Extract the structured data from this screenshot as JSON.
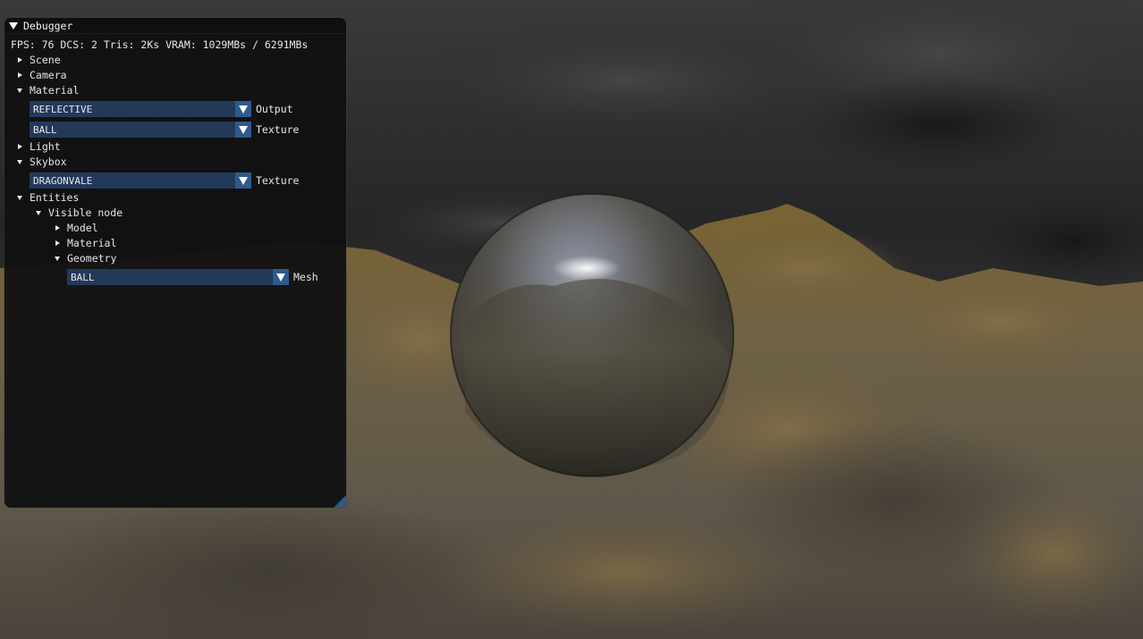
{
  "window": {
    "title": "Debugger",
    "stats": "FPS: 76 DCS: 2 Tris: 2Ks  VRAM: 1029MBs / 6291MBs"
  },
  "tree": {
    "scene": "Scene",
    "camera": "Camera",
    "material": {
      "label": "Material",
      "output": {
        "value": "REFLECTIVE",
        "label": "Output"
      },
      "texture": {
        "value": "BALL",
        "label": "Texture"
      }
    },
    "light": "Light",
    "skybox": {
      "label": "Skybox",
      "texture": {
        "value": "DRAGONVALE",
        "label": "Texture"
      }
    },
    "entities": {
      "label": "Entities",
      "visible_node": {
        "label": "Visible node",
        "model": "Model",
        "material": "Material",
        "geometry": {
          "label": "Geometry",
          "mesh": {
            "value": "BALL",
            "label": "Mesh"
          }
        }
      }
    }
  },
  "colors": {
    "combo_bg": "#23395a",
    "combo_button": "#2e5a8c",
    "window_bg": "#101011",
    "accent": "#2d5a8a"
  },
  "icons": {
    "expanded": "triangle-down-icon",
    "collapsed": "triangle-right-icon",
    "combo": "dropdown-arrow-icon"
  }
}
